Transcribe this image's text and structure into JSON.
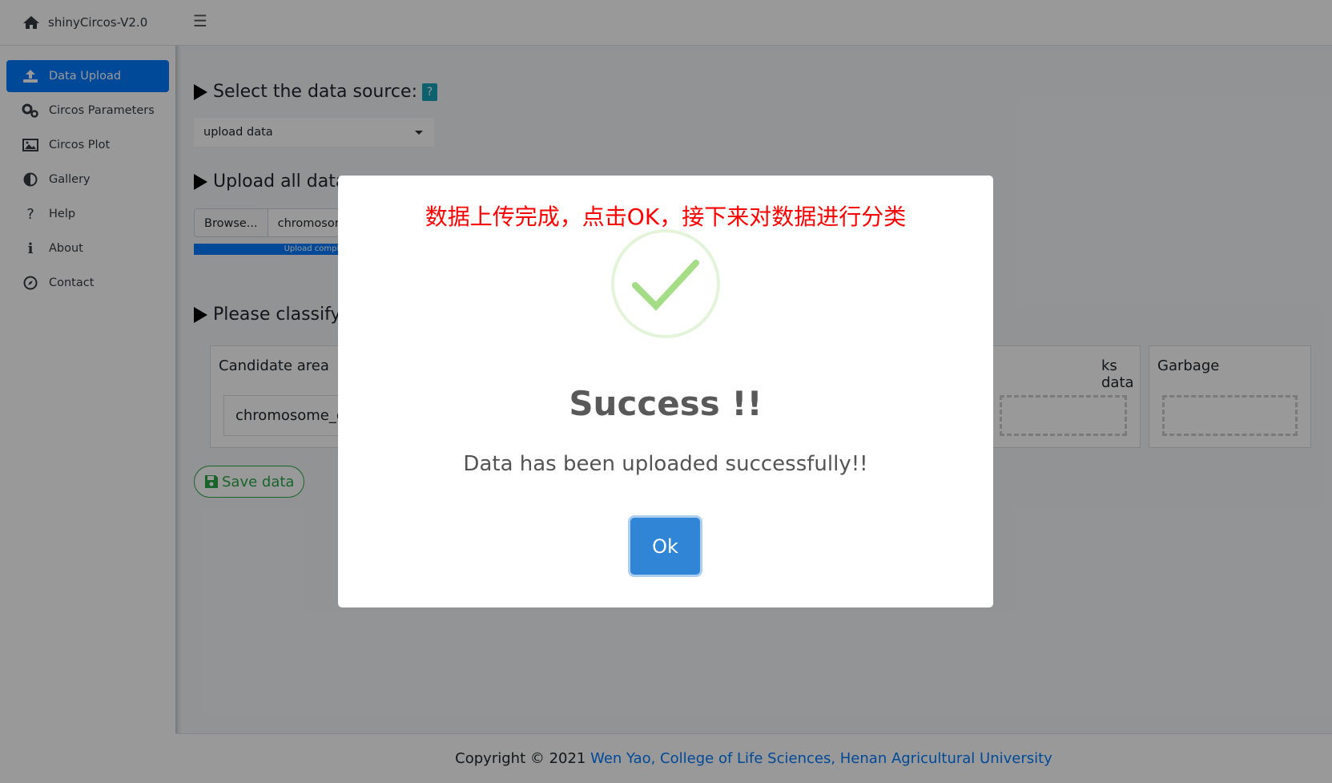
{
  "app": {
    "title": "shinyCircos-V2.0"
  },
  "sidebar": {
    "items": [
      {
        "label": "Data Upload",
        "icon": "upload-icon",
        "active": true
      },
      {
        "label": "Circos Parameters",
        "icon": "gears-icon",
        "active": false
      },
      {
        "label": "Circos Plot",
        "icon": "image-icon",
        "active": false
      },
      {
        "label": "Gallery",
        "icon": "half-circle-icon",
        "active": false
      },
      {
        "label": "Help",
        "icon": "question-icon",
        "active": false
      },
      {
        "label": "About",
        "icon": "info-icon",
        "active": false
      },
      {
        "label": "Contact",
        "icon": "compass-icon",
        "active": false
      }
    ]
  },
  "topbar": {
    "menu_icon": "☰"
  },
  "main": {
    "data_source": {
      "title": "Select the data source:",
      "help": "?",
      "selected": "upload data"
    },
    "upload": {
      "title": "Upload all data",
      "browse_label": "Browse...",
      "file_name": "chromosom",
      "progress_label": "Upload comple",
      "progress": 1.0
    },
    "classify": {
      "title": "Please classify t",
      "boxes": [
        {
          "title": "Candidate area",
          "item": "chromosome_g"
        },
        {
          "title": "ks data"
        },
        {
          "title": "Garbage"
        }
      ]
    },
    "save_label": "Save data"
  },
  "footer": {
    "prefix": "Copyright © 2021 ",
    "link": "Wen Yao, College of Life Sciences, Henan Agricultural University"
  },
  "modal": {
    "annotation": "数据上传完成，点击OK，接下来对数据进行分类",
    "icon": "success-check-icon",
    "title": "Success !!",
    "text": "Data has been uploaded successfully!!",
    "ok_label": "Ok"
  },
  "colors": {
    "primary": "#007bff",
    "success": "#28a745",
    "confirm": "#3085d6",
    "annotation": "#ff0000",
    "check": "#a5dc86"
  }
}
